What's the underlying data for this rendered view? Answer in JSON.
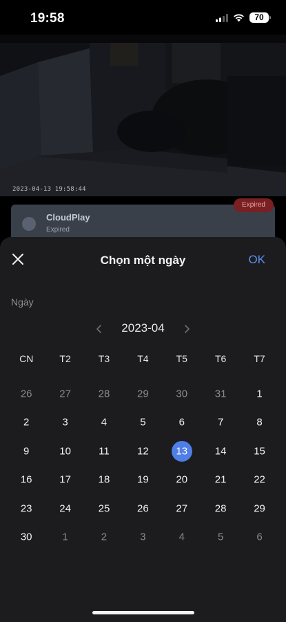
{
  "status_bar": {
    "time": "19:58",
    "battery": "70"
  },
  "camera": {
    "timestamp": "2023-04-13 19:58:44"
  },
  "cloud_card": {
    "title": "CloudPlay",
    "subtitle": "Expired",
    "badge": "Expired"
  },
  "sheet": {
    "title": "Chọn một ngày",
    "ok_label": "OK",
    "field_label": "Ngày",
    "month": "2023-04",
    "weekdays": [
      "CN",
      "T2",
      "T3",
      "T4",
      "T5",
      "T6",
      "T7"
    ],
    "selected_day": "13",
    "weeks": [
      [
        {
          "d": "26",
          "m": true
        },
        {
          "d": "27",
          "m": true
        },
        {
          "d": "28",
          "m": true
        },
        {
          "d": "29",
          "m": true
        },
        {
          "d": "30",
          "m": true
        },
        {
          "d": "31",
          "m": true
        },
        {
          "d": "1",
          "m": false
        }
      ],
      [
        {
          "d": "2",
          "m": false
        },
        {
          "d": "3",
          "m": false
        },
        {
          "d": "4",
          "m": false
        },
        {
          "d": "5",
          "m": false
        },
        {
          "d": "6",
          "m": false
        },
        {
          "d": "7",
          "m": false
        },
        {
          "d": "8",
          "m": false
        }
      ],
      [
        {
          "d": "9",
          "m": false
        },
        {
          "d": "10",
          "m": false
        },
        {
          "d": "11",
          "m": false
        },
        {
          "d": "12",
          "m": false
        },
        {
          "d": "13",
          "m": false
        },
        {
          "d": "14",
          "m": false
        },
        {
          "d": "15",
          "m": false
        }
      ],
      [
        {
          "d": "16",
          "m": false
        },
        {
          "d": "17",
          "m": false
        },
        {
          "d": "18",
          "m": false
        },
        {
          "d": "19",
          "m": false
        },
        {
          "d": "20",
          "m": false
        },
        {
          "d": "21",
          "m": false
        },
        {
          "d": "22",
          "m": false
        }
      ],
      [
        {
          "d": "23",
          "m": false
        },
        {
          "d": "24",
          "m": false
        },
        {
          "d": "25",
          "m": false
        },
        {
          "d": "26",
          "m": false
        },
        {
          "d": "27",
          "m": false
        },
        {
          "d": "28",
          "m": false
        },
        {
          "d": "29",
          "m": false
        }
      ],
      [
        {
          "d": "30",
          "m": false
        },
        {
          "d": "1",
          "m": true
        },
        {
          "d": "2",
          "m": true
        },
        {
          "d": "3",
          "m": true
        },
        {
          "d": "4",
          "m": true
        },
        {
          "d": "5",
          "m": true
        },
        {
          "d": "6",
          "m": true
        }
      ]
    ]
  },
  "colors": {
    "accent": "#4f7ee6",
    "ok": "#5b8ff0",
    "sheet_bg": "#1c1c1e",
    "badge_bg": "#7a1f22"
  },
  "icons": [
    "signal-icon",
    "wifi-icon",
    "battery-icon",
    "cloud-icon",
    "close-icon",
    "chevron-left-icon",
    "chevron-right-icon"
  ]
}
